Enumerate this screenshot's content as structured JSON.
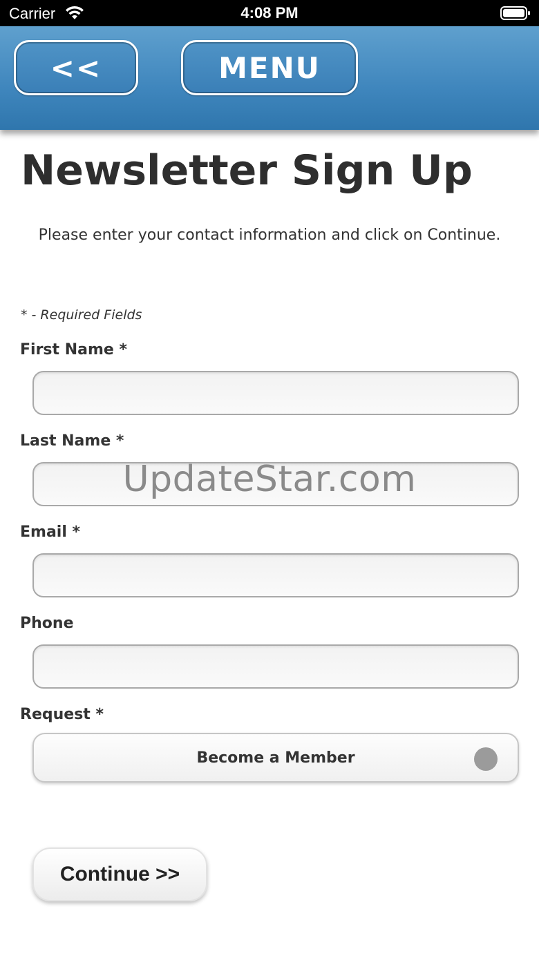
{
  "status_bar": {
    "carrier": "Carrier",
    "time": "4:08 PM",
    "wifi_icon": "wifi-icon",
    "battery_icon": "battery-icon"
  },
  "header": {
    "back_label": "<<",
    "menu_label": "MENU",
    "gradient_colors": [
      "#5fa0ce",
      "#2f76ad"
    ]
  },
  "page": {
    "title": "Newsletter Sign Up",
    "intro": "Please enter your contact information and click on Continue.",
    "required_note": "* - Required Fields"
  },
  "form": {
    "first_name": {
      "label": "First Name *",
      "value": ""
    },
    "last_name": {
      "label": "Last Name *",
      "value": ""
    },
    "email": {
      "label": "Email *",
      "value": ""
    },
    "phone": {
      "label": "Phone",
      "value": ""
    },
    "request": {
      "label": "Request *",
      "selected": "Become a Member"
    },
    "continue_label": "Continue >>"
  },
  "watermark": "UpdateStar.com"
}
